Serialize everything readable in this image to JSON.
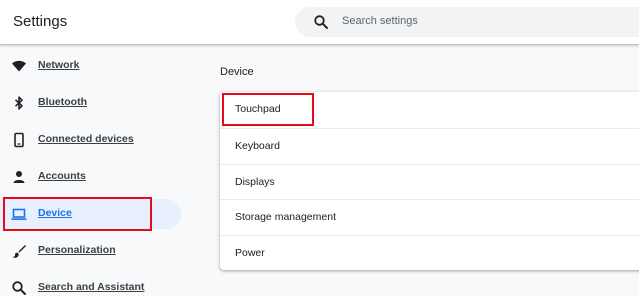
{
  "header": {
    "title": "Settings",
    "search": {
      "placeholder": "Search settings",
      "icon": "search-icon"
    }
  },
  "sidebar": {
    "items": [
      {
        "label": "Network",
        "icon": "wifi-icon"
      },
      {
        "label": "Bluetooth",
        "icon": "bluetooth-icon"
      },
      {
        "label": "Connected devices",
        "icon": "phone-icon"
      },
      {
        "label": "Accounts",
        "icon": "person-icon"
      },
      {
        "label": "Device",
        "icon": "laptop-icon",
        "selected": true
      },
      {
        "label": "Personalization",
        "icon": "brush-icon"
      },
      {
        "label": "Search and Assistant",
        "icon": "search-icon"
      }
    ]
  },
  "main": {
    "section_title": "Device",
    "rows": [
      {
        "label": "Touchpad"
      },
      {
        "label": "Keyboard"
      },
      {
        "label": "Displays"
      },
      {
        "label": "Storage management"
      },
      {
        "label": "Power"
      }
    ]
  },
  "colors": {
    "accent": "#1a73e8",
    "selected_bg": "#e8f0fe",
    "highlight_box": "#e50b1b",
    "background": "#f8f9fa"
  }
}
